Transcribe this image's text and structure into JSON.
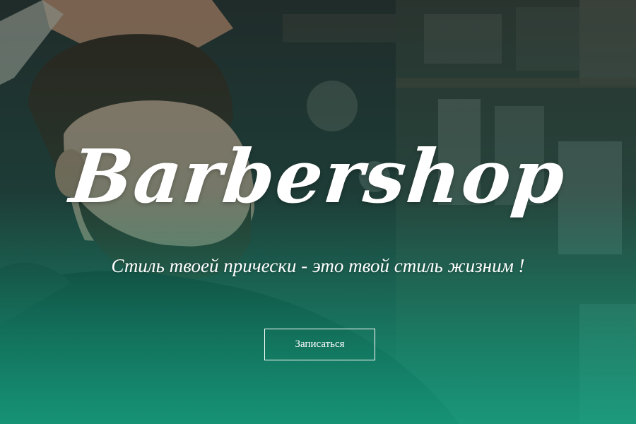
{
  "hero": {
    "title": "Barbershop",
    "subtitle": "Стиль твоей прически - это твой стиль жизним !",
    "cta_label": "Записаться",
    "overlay_color": "#16a080",
    "text_color": "#ffffff"
  }
}
